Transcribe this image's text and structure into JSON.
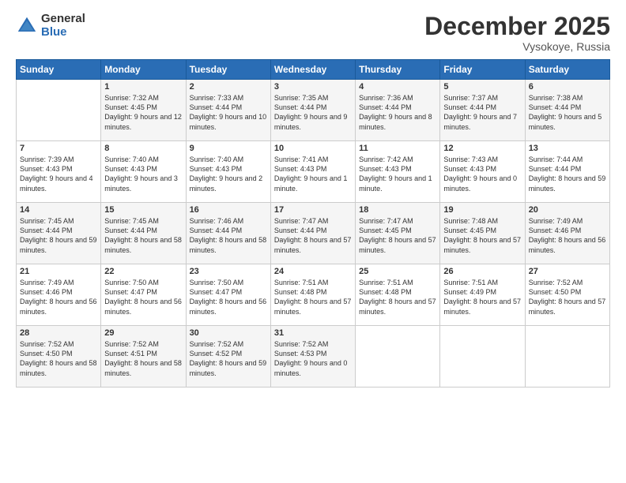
{
  "logo": {
    "general": "General",
    "blue": "Blue"
  },
  "calendar": {
    "title": "December 2025",
    "subtitle": "Vysokoye, Russia"
  },
  "header_days": [
    "Sunday",
    "Monday",
    "Tuesday",
    "Wednesday",
    "Thursday",
    "Friday",
    "Saturday"
  ],
  "weeks": [
    [
      {
        "day": "",
        "sunrise": "",
        "sunset": "",
        "daylight": ""
      },
      {
        "day": "1",
        "sunrise": "Sunrise: 7:32 AM",
        "sunset": "Sunset: 4:45 PM",
        "daylight": "Daylight: 9 hours and 12 minutes."
      },
      {
        "day": "2",
        "sunrise": "Sunrise: 7:33 AM",
        "sunset": "Sunset: 4:44 PM",
        "daylight": "Daylight: 9 hours and 10 minutes."
      },
      {
        "day": "3",
        "sunrise": "Sunrise: 7:35 AM",
        "sunset": "Sunset: 4:44 PM",
        "daylight": "Daylight: 9 hours and 9 minutes."
      },
      {
        "day": "4",
        "sunrise": "Sunrise: 7:36 AM",
        "sunset": "Sunset: 4:44 PM",
        "daylight": "Daylight: 9 hours and 8 minutes."
      },
      {
        "day": "5",
        "sunrise": "Sunrise: 7:37 AM",
        "sunset": "Sunset: 4:44 PM",
        "daylight": "Daylight: 9 hours and 7 minutes."
      },
      {
        "day": "6",
        "sunrise": "Sunrise: 7:38 AM",
        "sunset": "Sunset: 4:44 PM",
        "daylight": "Daylight: 9 hours and 5 minutes."
      }
    ],
    [
      {
        "day": "7",
        "sunrise": "Sunrise: 7:39 AM",
        "sunset": "Sunset: 4:43 PM",
        "daylight": "Daylight: 9 hours and 4 minutes."
      },
      {
        "day": "8",
        "sunrise": "Sunrise: 7:40 AM",
        "sunset": "Sunset: 4:43 PM",
        "daylight": "Daylight: 9 hours and 3 minutes."
      },
      {
        "day": "9",
        "sunrise": "Sunrise: 7:40 AM",
        "sunset": "Sunset: 4:43 PM",
        "daylight": "Daylight: 9 hours and 2 minutes."
      },
      {
        "day": "10",
        "sunrise": "Sunrise: 7:41 AM",
        "sunset": "Sunset: 4:43 PM",
        "daylight": "Daylight: 9 hours and 1 minute."
      },
      {
        "day": "11",
        "sunrise": "Sunrise: 7:42 AM",
        "sunset": "Sunset: 4:43 PM",
        "daylight": "Daylight: 9 hours and 1 minute."
      },
      {
        "day": "12",
        "sunrise": "Sunrise: 7:43 AM",
        "sunset": "Sunset: 4:43 PM",
        "daylight": "Daylight: 9 hours and 0 minutes."
      },
      {
        "day": "13",
        "sunrise": "Sunrise: 7:44 AM",
        "sunset": "Sunset: 4:44 PM",
        "daylight": "Daylight: 8 hours and 59 minutes."
      }
    ],
    [
      {
        "day": "14",
        "sunrise": "Sunrise: 7:45 AM",
        "sunset": "Sunset: 4:44 PM",
        "daylight": "Daylight: 8 hours and 59 minutes."
      },
      {
        "day": "15",
        "sunrise": "Sunrise: 7:45 AM",
        "sunset": "Sunset: 4:44 PM",
        "daylight": "Daylight: 8 hours and 58 minutes."
      },
      {
        "day": "16",
        "sunrise": "Sunrise: 7:46 AM",
        "sunset": "Sunset: 4:44 PM",
        "daylight": "Daylight: 8 hours and 58 minutes."
      },
      {
        "day": "17",
        "sunrise": "Sunrise: 7:47 AM",
        "sunset": "Sunset: 4:44 PM",
        "daylight": "Daylight: 8 hours and 57 minutes."
      },
      {
        "day": "18",
        "sunrise": "Sunrise: 7:47 AM",
        "sunset": "Sunset: 4:45 PM",
        "daylight": "Daylight: 8 hours and 57 minutes."
      },
      {
        "day": "19",
        "sunrise": "Sunrise: 7:48 AM",
        "sunset": "Sunset: 4:45 PM",
        "daylight": "Daylight: 8 hours and 57 minutes."
      },
      {
        "day": "20",
        "sunrise": "Sunrise: 7:49 AM",
        "sunset": "Sunset: 4:46 PM",
        "daylight": "Daylight: 8 hours and 56 minutes."
      }
    ],
    [
      {
        "day": "21",
        "sunrise": "Sunrise: 7:49 AM",
        "sunset": "Sunset: 4:46 PM",
        "daylight": "Daylight: 8 hours and 56 minutes."
      },
      {
        "day": "22",
        "sunrise": "Sunrise: 7:50 AM",
        "sunset": "Sunset: 4:47 PM",
        "daylight": "Daylight: 8 hours and 56 minutes."
      },
      {
        "day": "23",
        "sunrise": "Sunrise: 7:50 AM",
        "sunset": "Sunset: 4:47 PM",
        "daylight": "Daylight: 8 hours and 56 minutes."
      },
      {
        "day": "24",
        "sunrise": "Sunrise: 7:51 AM",
        "sunset": "Sunset: 4:48 PM",
        "daylight": "Daylight: 8 hours and 57 minutes."
      },
      {
        "day": "25",
        "sunrise": "Sunrise: 7:51 AM",
        "sunset": "Sunset: 4:48 PM",
        "daylight": "Daylight: 8 hours and 57 minutes."
      },
      {
        "day": "26",
        "sunrise": "Sunrise: 7:51 AM",
        "sunset": "Sunset: 4:49 PM",
        "daylight": "Daylight: 8 hours and 57 minutes."
      },
      {
        "day": "27",
        "sunrise": "Sunrise: 7:52 AM",
        "sunset": "Sunset: 4:50 PM",
        "daylight": "Daylight: 8 hours and 57 minutes."
      }
    ],
    [
      {
        "day": "28",
        "sunrise": "Sunrise: 7:52 AM",
        "sunset": "Sunset: 4:50 PM",
        "daylight": "Daylight: 8 hours and 58 minutes."
      },
      {
        "day": "29",
        "sunrise": "Sunrise: 7:52 AM",
        "sunset": "Sunset: 4:51 PM",
        "daylight": "Daylight: 8 hours and 58 minutes."
      },
      {
        "day": "30",
        "sunrise": "Sunrise: 7:52 AM",
        "sunset": "Sunset: 4:52 PM",
        "daylight": "Daylight: 8 hours and 59 minutes."
      },
      {
        "day": "31",
        "sunrise": "Sunrise: 7:52 AM",
        "sunset": "Sunset: 4:53 PM",
        "daylight": "Daylight: 9 hours and 0 minutes."
      },
      {
        "day": "",
        "sunrise": "",
        "sunset": "",
        "daylight": ""
      },
      {
        "day": "",
        "sunrise": "",
        "sunset": "",
        "daylight": ""
      },
      {
        "day": "",
        "sunrise": "",
        "sunset": "",
        "daylight": ""
      }
    ]
  ]
}
